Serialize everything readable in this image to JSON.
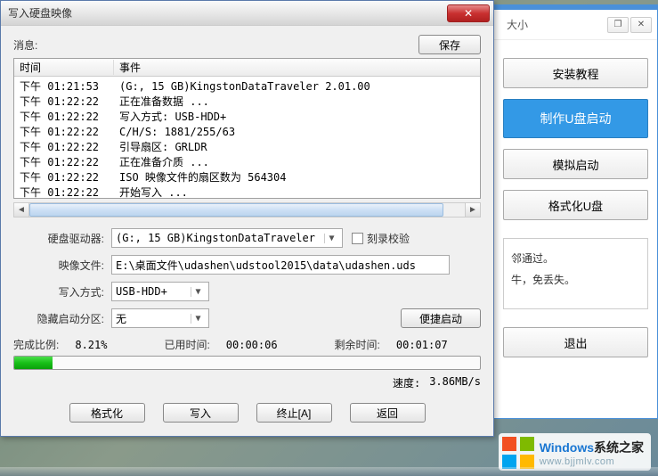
{
  "dialog": {
    "title": "写入硬盘映像",
    "info_label": "消息:",
    "save_label": "保存",
    "log_header": {
      "time": "时间",
      "event": "事件"
    },
    "log": [
      {
        "time": "下午 01:21:53",
        "event": "(G:, 15 GB)KingstonDataTraveler 2.01.00"
      },
      {
        "time": "下午 01:22:22",
        "event": "正在准备数据 ..."
      },
      {
        "time": "下午 01:22:22",
        "event": "写入方式: USB-HDD+"
      },
      {
        "time": "下午 01:22:22",
        "event": "C/H/S: 1881/255/63"
      },
      {
        "time": "下午 01:22:22",
        "event": "引导扇区: GRLDR"
      },
      {
        "time": "下午 01:22:22",
        "event": "正在准备介质 ..."
      },
      {
        "time": "下午 01:22:22",
        "event": "ISO 映像文件的扇区数为 564304"
      },
      {
        "time": "下午 01:22:22",
        "event": "开始写入 ..."
      }
    ],
    "fields": {
      "drive_label": "硬盘驱动器:",
      "drive_value": "(G:, 15 GB)KingstonDataTraveler 2.01.00",
      "verify_label": "刻录校验",
      "image_label": "映像文件:",
      "image_value": "E:\\桌面文件\\udashen\\udstool2015\\data\\udashen.uds",
      "write_mode_label": "写入方式:",
      "write_mode_value": "USB-HDD+",
      "hidden_label": "隐藏启动分区:",
      "hidden_value": "无",
      "quick_boot_label": "便捷启动"
    },
    "progress": {
      "percent_label": "完成比例:",
      "percent_value": "8.21%",
      "percent_num": 8.21,
      "elapsed_label": "已用时间:",
      "elapsed_value": "00:00:06",
      "remaining_label": "剩余时间:",
      "remaining_value": "00:01:07",
      "speed_label": "速度:",
      "speed_value": "3.86MB/s"
    },
    "buttons": {
      "format": "格式化",
      "write": "写入",
      "abort": "终止[A]",
      "return": "返回"
    }
  },
  "side": {
    "size_label": "大小",
    "install_tutorial": "安装教程",
    "make_usb": "制作U盘启动",
    "sim_boot": "模拟启动",
    "format_usb": "格式化U盘",
    "text_line1": "邻通过。",
    "text_line2": "牛，免丢失。",
    "exit": "退出"
  },
  "watermark": {
    "brand_blue": "Windows",
    "brand_black": "系统之家",
    "url": "www.bjjmlv.com"
  }
}
